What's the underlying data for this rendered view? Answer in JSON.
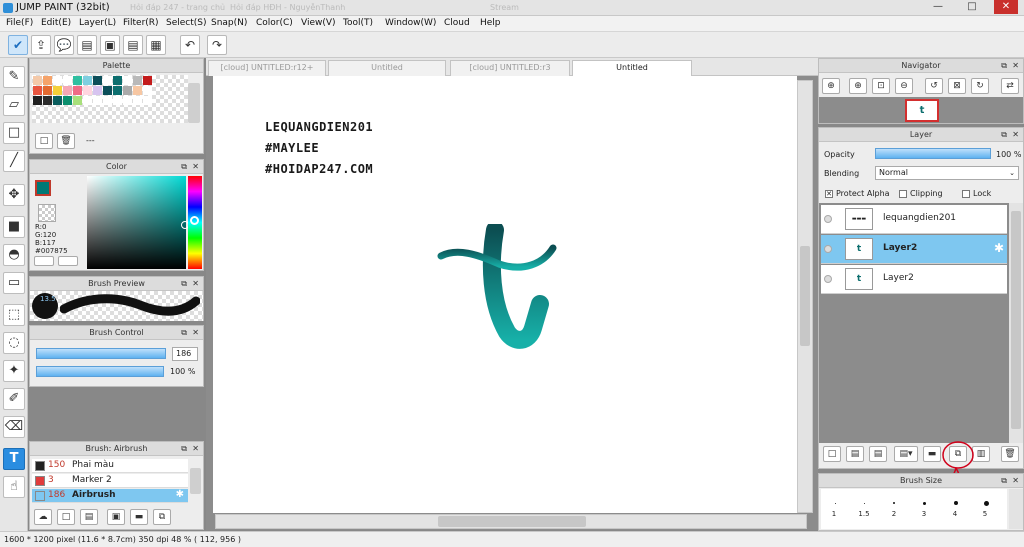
{
  "titlebar": {
    "title": "JUMP PAINT (32bit)",
    "faded_tabs": [
      "Hỏi đáp 247 - trang chủ",
      "Hỏi đáp HĐH - NguyễnThanh",
      "Stream"
    ],
    "buttons": {
      "minimize": "—",
      "maximize": "□",
      "close": "✕"
    }
  },
  "menu": [
    "File(F)",
    "Edit(E)",
    "Layer(L)",
    "Filter(R)",
    "Select(S)",
    "Snap(N)",
    "Color(C)",
    "View(V)",
    "Tool(T)",
    "Window(W)",
    "Cloud",
    "Help"
  ],
  "toolbar": {
    "icons": [
      "check-icon",
      "share-icon",
      "comment-icon",
      "chat-icon",
      "document-icon",
      "page-icon",
      "grid-icon",
      "undo-icon",
      "redo-icon"
    ],
    "glyphs": [
      "✔",
      "⇪",
      "💬",
      "▤",
      "▣",
      "▤",
      "▦",
      "↶",
      "↷"
    ]
  },
  "tools": [
    {
      "name": "pen-tool",
      "glyph": "✎"
    },
    {
      "name": "eraser-tool",
      "glyph": "▱"
    },
    {
      "name": "rect-tool",
      "glyph": "□"
    },
    {
      "name": "line-tool",
      "glyph": "╱"
    },
    {
      "name": "move-tool",
      "glyph": "✥"
    },
    {
      "name": "fill-rect-tool",
      "glyph": "■"
    },
    {
      "name": "bucket-tool",
      "glyph": "◓"
    },
    {
      "name": "gradient-tool",
      "glyph": "▭"
    },
    {
      "name": "select-rect-tool",
      "glyph": "⬚"
    },
    {
      "name": "lasso-tool",
      "glyph": "◌"
    },
    {
      "name": "magic-wand-tool",
      "glyph": "✦"
    },
    {
      "name": "select-pen-tool",
      "glyph": "✐"
    },
    {
      "name": "select-eraser-tool",
      "glyph": "⌫"
    },
    {
      "name": "text-tool",
      "glyph": "T"
    },
    {
      "name": "hand-tool",
      "glyph": "☝"
    }
  ],
  "palette": {
    "title": "Palette",
    "swatches": [
      "#f4c9a9",
      "#f5a36a",
      "#ffffff",
      "#ffffff",
      "#2fbfa0",
      "#7ecfe0",
      "#0c4f5a",
      "#ffffff",
      "#0c6e6e",
      "#ffffff",
      "#b9b9b9",
      "#c41b1b",
      "#e8553f",
      "#e36a30",
      "#f3d03a",
      "#f5a8b5",
      "#f06b86",
      "#ffd6e0",
      "#d7c4f0",
      "#0c4f5a",
      "#0c6e6e",
      "#aaaaaa",
      "#f7c7a3",
      "#ffffff",
      "#1f1f1f",
      "#2b2b2b",
      "#0a5d5d",
      "#0c8f6e",
      "#a8e07b",
      "#ffffff",
      "#ffffff",
      "#ffffff",
      "#ffffff",
      "#ffffff",
      "#ffffff",
      "#ffffff"
    ],
    "footer": "---"
  },
  "color": {
    "title": "Color",
    "r": "R:0",
    "g": "G:120",
    "b": "B:117",
    "hex": "#007875",
    "fg": "#007875",
    "bg": "#ffffff"
  },
  "brush_preview": {
    "title": "Brush Preview",
    "size": "13.5"
  },
  "brush_control": {
    "title": "Brush Control",
    "size_value": "186",
    "opacity_value": "100 %"
  },
  "brushes": {
    "title": "Brush: Airbrush",
    "items": [
      {
        "num": "150",
        "name": "Phai màu",
        "color": "#222222"
      },
      {
        "num": "3",
        "name": "Marker 2",
        "color": "#e03c3c"
      },
      {
        "num": "186",
        "name": "Airbrush",
        "color": "#7ec7f0"
      }
    ]
  },
  "tabs": [
    {
      "label": "[cloud] UNTITLED:r12+",
      "active": false
    },
    {
      "label": "Untitled",
      "active": false
    },
    {
      "label": "[cloud] UNTITLED:r3",
      "active": false
    },
    {
      "label": "Untitled",
      "active": true
    }
  ],
  "canvas": {
    "watermark_lines": [
      "LEQUANGDIEN201",
      "#MAYLEE",
      "#HOIDAP247.COM"
    ]
  },
  "navigator": {
    "title": "Navigator"
  },
  "layer": {
    "title": "Layer",
    "opacity_label": "Opacity",
    "opacity_value": "100 %",
    "blending_label": "Blending",
    "blending_value": "Normal",
    "protect_alpha": "Protect Alpha",
    "clipping": "Clipping",
    "lock": "Lock",
    "items": [
      {
        "name": "lequangdien201",
        "selected": false,
        "bold": false
      },
      {
        "name": "Layer2",
        "selected": true,
        "bold": true
      },
      {
        "name": "Layer2",
        "selected": false,
        "bold": false
      }
    ]
  },
  "brush_size": {
    "title": "Brush Size",
    "sizes": [
      "1",
      "1.5",
      "2",
      "3",
      "4",
      "5"
    ]
  },
  "status": "1600 * 1200 pixel   (11.6 * 8.7cm)   350 dpi   48 %   ( 112, 956 )"
}
